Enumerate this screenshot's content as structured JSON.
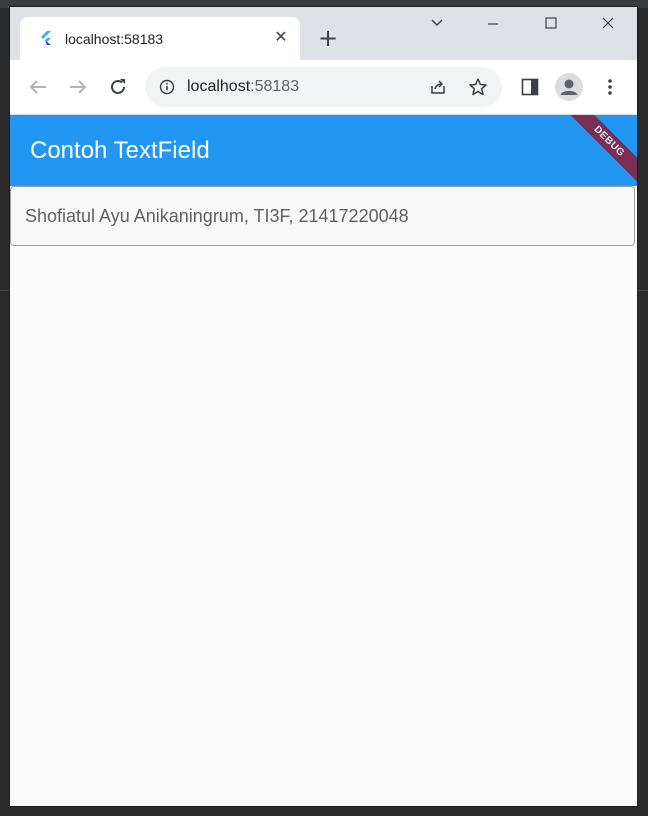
{
  "browser": {
    "tab": {
      "title": "localhost:58183",
      "favicon": "flutter-icon"
    },
    "new_tab_symbol": "+",
    "close_tab_symbol": "✕",
    "omnibox": {
      "host": "localhost",
      "port": ":58183"
    }
  },
  "app": {
    "title": "Contoh TextField",
    "debug_banner": "DEBUG",
    "textfield": {
      "value": "Shofiatul Ayu Anikaningrum, TI3F, 21417220048"
    },
    "colors": {
      "primary": "#2196f3",
      "background": "#fafafa",
      "banner": "#8b1d3a"
    }
  }
}
